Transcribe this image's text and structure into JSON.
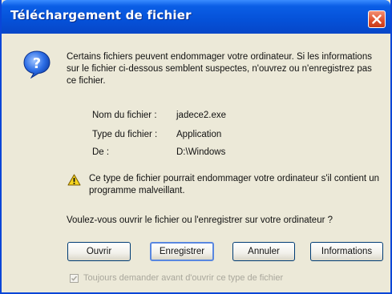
{
  "dialog": {
    "title": "Téléchargement de fichier",
    "message": "Certains fichiers peuvent endommager votre ordinateur. Si les informations sur le fichier ci-dessous semblent suspectes, n'ouvrez ou n'enregistrez pas ce fichier.",
    "file_info": {
      "name_label": "Nom du fichier :",
      "name_value": "jadece2.exe",
      "type_label": "Type du fichier :",
      "type_value": "Application",
      "from_label": "De :",
      "from_value": "D:\\Windows"
    },
    "warning": "Ce type de fichier pourrait endommager votre ordinateur s'il contient un programme malveillant.",
    "question": "Voulez-vous ouvrir le fichier ou l'enregistrer sur votre ordinateur ?",
    "buttons": {
      "open": "Ouvrir",
      "save": "Enregistrer",
      "cancel": "Annuler",
      "info": "Informations"
    },
    "checkbox": {
      "label": "Toujours demander avant d'ouvrir ce type de fichier",
      "checked": true,
      "disabled": true
    },
    "icons": {
      "main": "question-icon",
      "warning": "warning-icon",
      "close": "close-icon"
    },
    "colors": {
      "titlebar": "#0551d8",
      "close_button": "#dd4f2c",
      "dialog_bg": "#ece9d8"
    }
  }
}
